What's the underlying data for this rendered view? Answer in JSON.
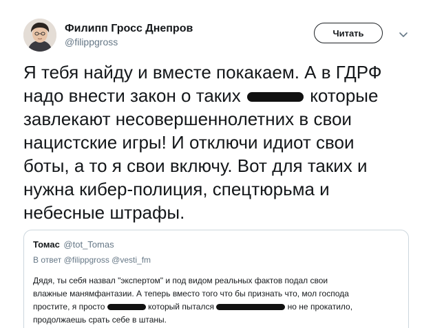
{
  "author": {
    "name": "Филипп Гросс Днепров",
    "handle": "@filippgross"
  },
  "actions": {
    "follow_label": "Читать",
    "menu_icon": "chevron-down-icon"
  },
  "tweet": {
    "lines": [
      "Я тебя найду и вместе покакаем. А в ГДРФ",
      "надо внести закон о таких",
      "которые",
      "завлекают несовершеннолетних в свои",
      "нацистские игры! И отключи идиот свои",
      "боты, а то я свои включу. Вот для таких и",
      "нужна кибер-полиция, спецтюрьма и",
      "небесные штрафы."
    ]
  },
  "quote": {
    "name": "Томас",
    "handle": "@tot_Tomas",
    "reply_prefix": "В ответ",
    "reply_mentions": [
      "@filippgross",
      "@vesti_fm"
    ],
    "lines": [
      "Дядя, ты себя назвал \"экспертом\" и под видом реальных фактов подал свои",
      "влажные манямфантазии. А теперь вместо того что бы признать что, мол господа",
      "простите, я просто",
      "который пытался",
      "но не прокатило,",
      "продолжаешь срать себе в штаны."
    ]
  },
  "colors": {
    "text": "#14171a",
    "secondary": "#657786",
    "border": "#ccd6dd",
    "redaction": "#111111"
  }
}
